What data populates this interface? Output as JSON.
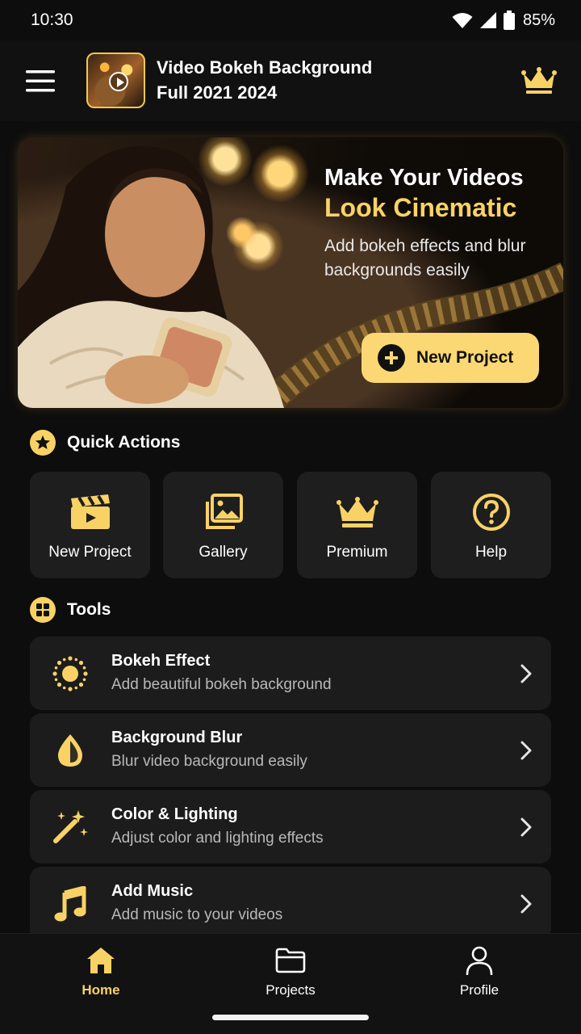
{
  "status_bar": {
    "time": "10:30",
    "battery": "85%"
  },
  "app_bar": {
    "title_line1": "Video Bokeh Background",
    "title_line2": "Full 2021 2024",
    "menu_icon": "hamburger-menu-icon",
    "premium_icon": "crown-icon"
  },
  "hero": {
    "line1": "Make Your Videos",
    "line2": "Look Cinematic",
    "subtitle": "Add bokeh effects and blur backgrounds easily",
    "button_label": "New Project"
  },
  "quick_actions": {
    "title": "Quick Actions",
    "items": [
      {
        "label": "New Project",
        "icon": "clapperboard-icon"
      },
      {
        "label": "Gallery",
        "icon": "gallery-icon"
      },
      {
        "label": "Premium",
        "icon": "crown-icon"
      },
      {
        "label": "Help",
        "icon": "help-icon"
      }
    ]
  },
  "tools": {
    "title": "Tools",
    "items": [
      {
        "title": "Bokeh Effect",
        "subtitle": "Add beautiful bokeh background",
        "icon": "bokeh-sun-icon"
      },
      {
        "title": "Background Blur",
        "subtitle": "Blur video background easily",
        "icon": "droplet-icon"
      },
      {
        "title": "Color & Lighting",
        "subtitle": "Adjust color and lighting effects",
        "icon": "magic-wand-icon"
      },
      {
        "title": "Add Music",
        "subtitle": "Add music to your videos",
        "icon": "music-note-icon"
      }
    ]
  },
  "bottom_nav": {
    "items": [
      {
        "label": "Home",
        "icon": "home-icon",
        "active": true
      },
      {
        "label": "Projects",
        "icon": "folder-icon",
        "active": false
      },
      {
        "label": "Profile",
        "icon": "profile-icon",
        "active": false
      }
    ]
  },
  "colors": {
    "accent": "#f9d266",
    "background": "#0d0d0d",
    "card": "#1e1e1e"
  }
}
